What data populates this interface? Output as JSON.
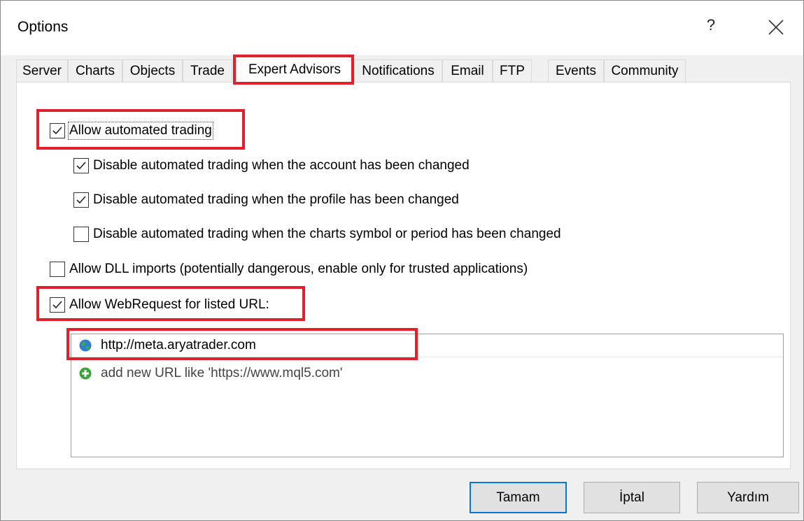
{
  "window": {
    "title": "Options",
    "help_label": "?",
    "close_label": "✕"
  },
  "tabs": [
    {
      "label": "Server"
    },
    {
      "label": "Charts"
    },
    {
      "label": "Objects"
    },
    {
      "label": "Trade"
    },
    {
      "label": "Expert Advisors",
      "active": true
    },
    {
      "label": "Notifications"
    },
    {
      "label": "Email"
    },
    {
      "label": "FTP"
    },
    {
      "label": "Events"
    },
    {
      "label": "Community"
    }
  ],
  "options": {
    "allow_automated_trading": {
      "label": "Allow automated trading",
      "checked": true
    },
    "disable_account_changed": {
      "label": "Disable automated trading when the account has been changed",
      "checked": true
    },
    "disable_profile_changed": {
      "label": "Disable automated trading when the profile has been changed",
      "checked": true
    },
    "disable_symbol_changed": {
      "label": "Disable automated trading when the charts symbol or period has been changed",
      "checked": false
    },
    "allow_dll": {
      "label": "Allow DLL imports (potentially dangerous, enable only for trusted applications)",
      "checked": false
    },
    "allow_webrequest": {
      "label": "Allow WebRequest for listed URL:",
      "checked": true
    }
  },
  "url_list": {
    "items": [
      "http://meta.aryatrader.com"
    ],
    "add_hint": "add new URL like 'https://www.mql5.com'"
  },
  "buttons": {
    "ok": "Tamam",
    "cancel": "İptal",
    "help": "Yardım"
  },
  "colors": {
    "highlight": "#e0202a",
    "default_button_border": "#0078d7"
  },
  "icons": {
    "url_item": "globe-icon",
    "add_url": "plus-circle-icon"
  }
}
